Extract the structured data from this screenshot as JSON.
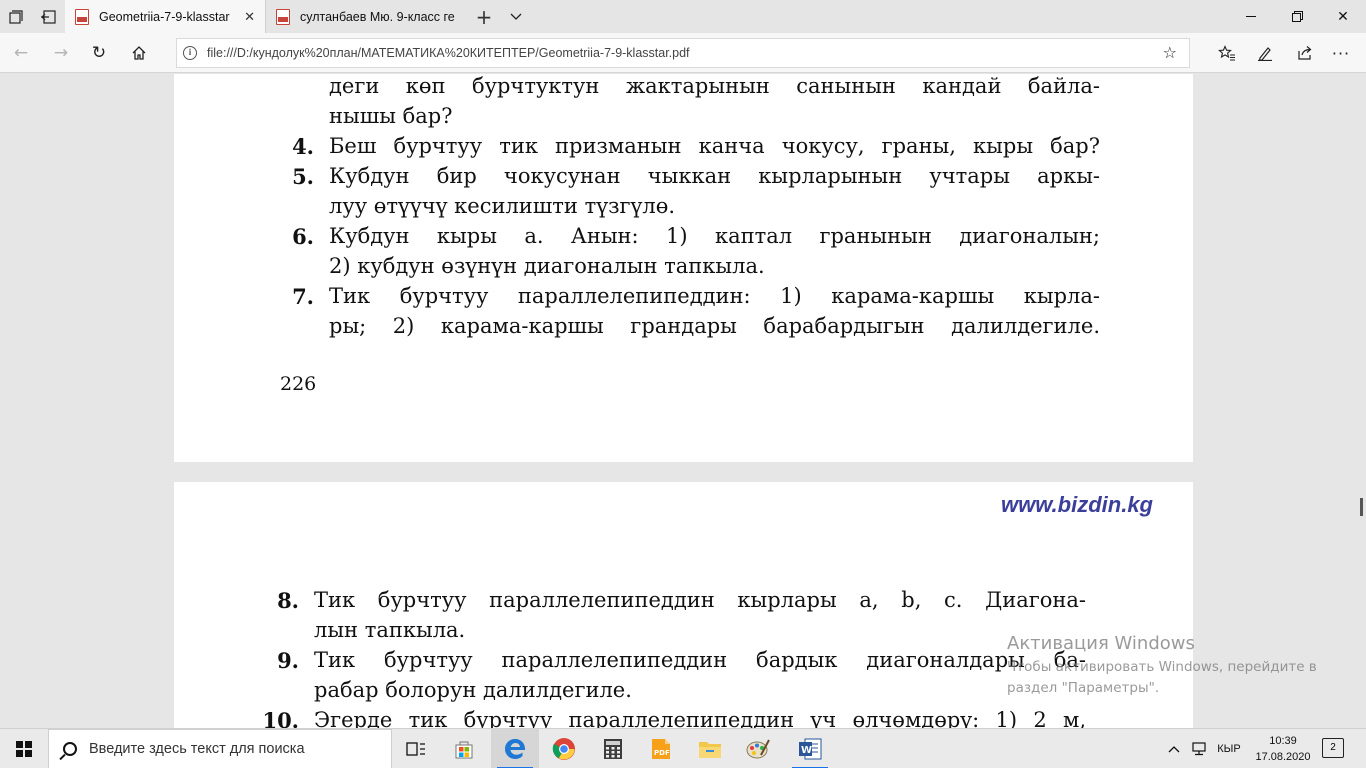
{
  "tabs": [
    {
      "title": "Geometriia-7-9-klasstar",
      "active": true,
      "icon": "pdf-icon"
    },
    {
      "title": "султанбаев Мю. 9-класс ге",
      "active": false,
      "icon": "pdf-icon"
    }
  ],
  "address_bar": {
    "url": "file:///D:/кундолук%20план/МАТЕМАТИКА%20КИТЕПТЕР/Geometriia-7-9-klasstar.pdf"
  },
  "document": {
    "page1": {
      "lines": [
        {
          "num": "",
          "text": "деги көп бурчтуктун жактарынын санынын кандай байла-",
          "justify": true
        },
        {
          "num": "",
          "text": "нышы бар?",
          "justify": false
        },
        {
          "num": "4.",
          "text": "Беш бурчтуу тик призманын канча чокусу, граны, кыры бар?",
          "justify": true
        },
        {
          "num": "5.",
          "text": "Кубдун бир чокусунан чыккан кырларынын учтары аркы-",
          "justify": true
        },
        {
          "num": "",
          "text": "луу өтүүчү кесилишти түзгүлө.",
          "justify": false
        },
        {
          "num": "6.",
          "text": "Кубдун кыры a. Анын: 1) каптал гранынын диагоналын;",
          "justify": true
        },
        {
          "num": "",
          "text": "2) кубдун өзүнүн диагоналын тапкыла.",
          "justify": false
        },
        {
          "num": "7.",
          "text": "Тик бурчтуу параллелепипеддин: 1) карама-каршы кырла-",
          "justify": true
        },
        {
          "num": "",
          "text": "ры; 2) карама-каршы грандары барабардыгын далилдегиле.",
          "justify": true
        }
      ],
      "page_number": "226"
    },
    "page2": {
      "site": "www.bizdin.kg",
      "lines": [
        {
          "num": "8.",
          "text": "Тик бурчтуу параллелепипеддин кырлары a, b, c. Диагона-",
          "justify": true
        },
        {
          "num": "",
          "text": "лын тапкыла.",
          "justify": false
        },
        {
          "num": "9.",
          "text": "Тик бурчтуу параллелепипеддин бардык диагоналдары ба-",
          "justify": true
        },
        {
          "num": "",
          "text": "рабар болорун далилдегиле.",
          "justify": false
        },
        {
          "num": "10.",
          "text": "Эгерде тик бурчтуу параллелепипеддин үч өлчөмдөрү: 1) 2 м,",
          "justify": true
        }
      ]
    }
  },
  "watermark": {
    "title": "Активация Windows",
    "line1": "Чтобы активировать Windows, перейдите в",
    "line2": "раздел \"Параметры\"."
  },
  "taskbar": {
    "search_placeholder": "Введите здесь текст для поиска",
    "language": "КЫР",
    "time": "10:39",
    "date": "17.08.2020",
    "notifications": "2"
  }
}
